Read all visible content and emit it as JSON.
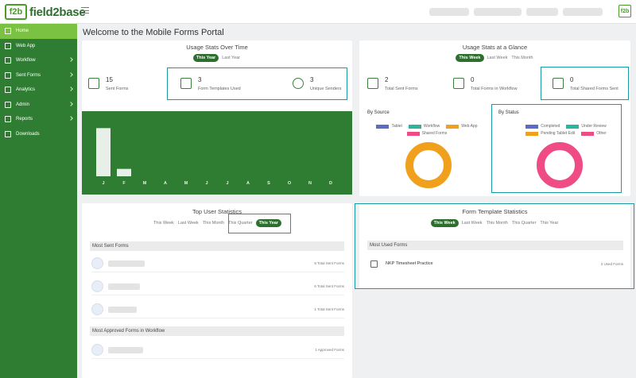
{
  "app": {
    "logo_text": "field2base",
    "logo_mark": "f2b",
    "logo_small": "f2b"
  },
  "sidebar": {
    "items": [
      {
        "label": "Home",
        "icon": "home-icon",
        "active": true,
        "chevron": false
      },
      {
        "label": "Web App",
        "icon": "monitor-icon",
        "active": false,
        "chevron": false
      },
      {
        "label": "Workflow",
        "icon": "workflow-icon",
        "active": false,
        "chevron": true
      },
      {
        "label": "Sent Forms",
        "icon": "send-icon",
        "active": false,
        "chevron": true
      },
      {
        "label": "Analytics",
        "icon": "chart-icon",
        "active": false,
        "chevron": true
      },
      {
        "label": "Admin",
        "icon": "admin-icon",
        "active": false,
        "chevron": true
      },
      {
        "label": "Reports",
        "icon": "filter-icon",
        "active": false,
        "chevron": true
      },
      {
        "label": "Downloads",
        "icon": "download-icon",
        "active": false,
        "chevron": false
      }
    ]
  },
  "page": {
    "title": "Welcome to the Mobile Forms Portal"
  },
  "usage_time": {
    "title": "Usage Stats Over Time",
    "filters": [
      "This Year",
      "Last Year"
    ],
    "active_filter": "This Year",
    "stats": [
      {
        "value": "15",
        "label": "Sent Forms"
      },
      {
        "value": "3",
        "label": "Form Templates Used"
      },
      {
        "value": "3",
        "label": "Unique Senders"
      }
    ]
  },
  "chart_data": {
    "type": "bar",
    "categories": [
      "J",
      "F",
      "M",
      "A",
      "M",
      "J",
      "J",
      "A",
      "S",
      "O",
      "N",
      "D"
    ],
    "values": [
      13,
      2,
      0,
      0,
      0,
      0,
      0,
      0,
      0,
      0,
      0,
      0
    ],
    "ylim": [
      0,
      15
    ]
  },
  "glance": {
    "title": "Usage Stats at a Glance",
    "filters": [
      "This Week",
      "Last Week",
      "This Month"
    ],
    "active_filter": "This Week",
    "stats": [
      {
        "value": "2",
        "label": "Total Sent Forms"
      },
      {
        "value": "0",
        "label": "Total Forms in Workflow"
      },
      {
        "value": "0",
        "label": "Total Shared Forms Sent"
      }
    ],
    "by_source": {
      "title": "By Source",
      "legend": [
        {
          "label": "Tablet",
          "color": "#5b6cc7"
        },
        {
          "label": "Workflow",
          "color": "#2bb5a0"
        },
        {
          "label": "Web App",
          "color": "#f0a01c"
        },
        {
          "label": "Shared Forms",
          "color": "#ef4b84"
        }
      ],
      "donut_color": "#f0a01c"
    },
    "by_status": {
      "title": "By Status",
      "legend": [
        {
          "label": "Completed",
          "color": "#5b6cc7"
        },
        {
          "label": "Under Review",
          "color": "#2bb5a0"
        },
        {
          "label": "Pending Tablet Edit",
          "color": "#f0a01c"
        },
        {
          "label": "Other",
          "color": "#ef4b84"
        }
      ],
      "donut_color": "#ef4b84"
    }
  },
  "top_users": {
    "title": "Top User Statistics",
    "filters": [
      "This Week",
      "Last Week",
      "This Month",
      "This Quarter",
      "This Year"
    ],
    "active_filter": "This Year",
    "most_sent_header": "Most Sent Forms",
    "most_sent": [
      {
        "count": "8 Total Sent Forms"
      },
      {
        "count": "6 Total Sent Forms"
      },
      {
        "count": "1 Total Sent Forms"
      }
    ],
    "approved_header": "Most Approved Forms in Workflow",
    "approved": [
      {
        "count": "1 Approved Forms"
      }
    ]
  },
  "form_stats": {
    "title": "Form Template Statistics",
    "filters": [
      "This Week",
      "Last Week",
      "This Month",
      "This Quarter",
      "This Year"
    ],
    "active_filter": "This Week",
    "most_used_header": "Most Used Forms",
    "rows": [
      {
        "name": "NKP Timesheet Practice",
        "count": "2 Used Forms"
      }
    ]
  },
  "colors": {
    "sidebar": "#2f7d32",
    "active": "#7cc242",
    "highlight": "#1a9aa3"
  }
}
